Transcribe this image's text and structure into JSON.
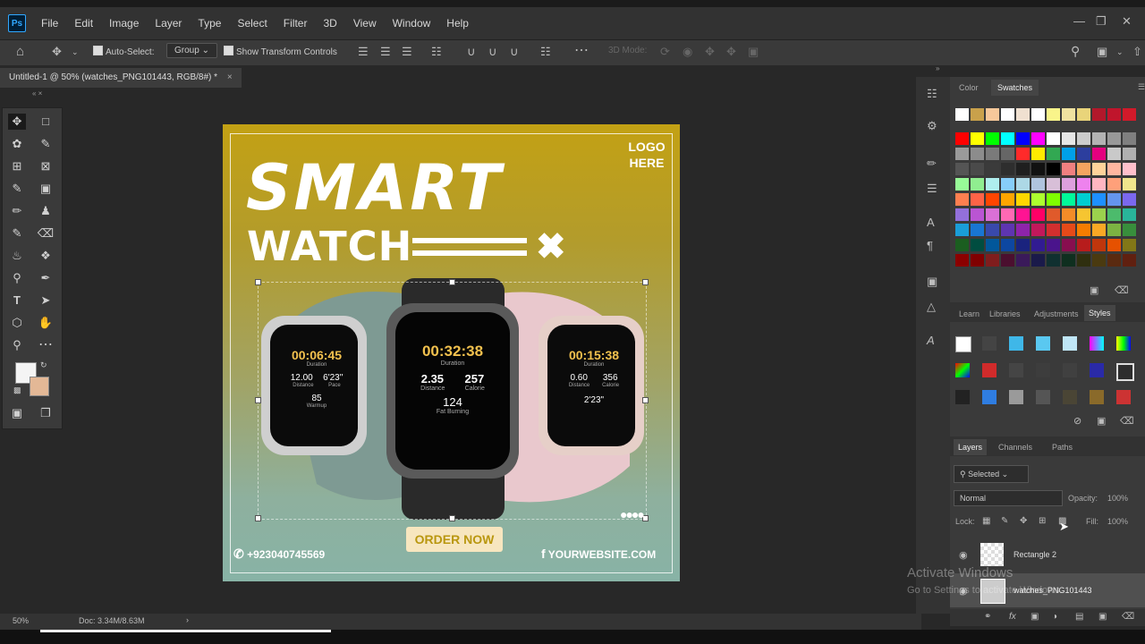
{
  "app": {
    "icon_label": "Ps"
  },
  "menu": [
    "File",
    "Edit",
    "Image",
    "Layer",
    "Type",
    "Select",
    "Filter",
    "3D",
    "View",
    "Window",
    "Help"
  ],
  "options": {
    "auto_select_label": "Auto-Select:",
    "auto_select_value": "Group",
    "show_transform_label": "Show Transform Controls",
    "mode_3d_label": "3D Mode:"
  },
  "document": {
    "tab_title": "Untitled-1 @ 50% (watches_PNG101443, RGB/8#) *"
  },
  "artwork": {
    "headline": "SMART",
    "subheadline": "WATCH",
    "logo_text": "LOGO HERE",
    "cta": "ORDER NOW",
    "phone": "+923040745569",
    "website": "YOURWEBSITE.COM",
    "watches": [
      {
        "time": "00:06:45",
        "label": "Duration",
        "stat1": "12.00",
        "stat1_label": "Distance",
        "stat2": "6'23\"",
        "stat2_label": "Pace",
        "hr": "85",
        "hr_label": "Warmup"
      },
      {
        "time": "00:32:38",
        "label": "Duration",
        "stat1": "2.35",
        "stat1_label": "Distance",
        "stat2": "257",
        "stat2_label": "Calorie",
        "hr": "124",
        "hr_label": "Fat Burning"
      },
      {
        "time": "00:15:38",
        "label": "Duration",
        "stat1": "0.60",
        "stat1_label": "Distance",
        "stat2": "356",
        "stat2_label": "Calorie",
        "hr": "2'23\"",
        "hr_label": ""
      }
    ]
  },
  "panels": {
    "color_tab": "Color",
    "swatches_tab": "Swatches",
    "lower_tabs": [
      "Learn",
      "Libraries",
      "Adjustments",
      "Styles"
    ],
    "layers_tabs": [
      "Layers",
      "Channels",
      "Paths"
    ],
    "filter_value": "Selected",
    "blend_mode": "Normal",
    "opacity_label": "Opacity:",
    "opacity_value": "100%",
    "lock_label": "Lock:",
    "fill_label": "Fill:",
    "fill_value": "100%",
    "layers": [
      {
        "name": "Rectangle 2"
      },
      {
        "name": "watches_PNG101443"
      }
    ]
  },
  "status": {
    "zoom": "50%",
    "doc_size": "Doc: 3.34M/8.63M"
  },
  "watermark": {
    "line1": "Activate Windows",
    "line2": "Go to Settings to activate Windows."
  },
  "swatch_colors": {
    "row1": [
      "#ffffff",
      "#c9a14b",
      "#f6c89a",
      "#ffffff",
      "#f0e0d0",
      "#ffffff",
      "#f9f48a",
      "#f0e2a0",
      "#e9d47a",
      "#b2182b",
      "#c0152c",
      "#d11a2a"
    ],
    "grid": [
      [
        "#ff0000",
        "#ffff00",
        "#00ff00",
        "#00ffff",
        "#0000ff",
        "#ff00ff",
        "#ffffff",
        "#e6e6e6",
        "#cccccc",
        "#b3b3b3",
        "#999999",
        "#808080"
      ],
      [
        "#9a9a9a",
        "#8c8c8c",
        "#7a7a7a",
        "#666666",
        "#ff2a2a",
        "#ffeb00",
        "#32a852",
        "#00a0e9",
        "#2c3e9e",
        "#e4007f",
        "#c9c9c9",
        "#b0b0b0"
      ],
      [
        "#555555",
        "#4a4a4a",
        "#3b3b3b",
        "#2e2e2e",
        "#1f1f1f",
        "#111111",
        "#000000",
        "#f08080",
        "#f4a460",
        "#ffd39b",
        "#ffb6a0",
        "#ffc0cb"
      ],
      [
        "#98fb98",
        "#90ee90",
        "#afeeee",
        "#87cefa",
        "#add8e6",
        "#b0c4de",
        "#d8bfd8",
        "#dda0dd",
        "#ee82ee",
        "#ffb6c1",
        "#ffa07a",
        "#f0e68c"
      ],
      [
        "#ff7f50",
        "#ff6347",
        "#ff4500",
        "#ffa500",
        "#ffd700",
        "#adff2f",
        "#7fff00",
        "#00fa9a",
        "#00ced1",
        "#1e90ff",
        "#6495ed",
        "#7b68ee"
      ],
      [
        "#9370db",
        "#ba55d3",
        "#da70d6",
        "#ff69b4",
        "#ff1493",
        "#ff0066",
        "#e05a2b",
        "#f28c28",
        "#f6c531",
        "#9bd14d",
        "#4cbb6c",
        "#29b59a"
      ],
      [
        "#1a9ed8",
        "#1976d2",
        "#3949ab",
        "#5e35b1",
        "#8e24aa",
        "#c2185b",
        "#d32f2f",
        "#e64a19",
        "#f57c00",
        "#f9a825",
        "#7cb342",
        "#388e3c"
      ],
      [
        "#1b5e20",
        "#004d40",
        "#01579b",
        "#0d47a1",
        "#1a237e",
        "#311b92",
        "#4a148c",
        "#880e4f",
        "#b71c1c",
        "#bf360c",
        "#e65100",
        "#827717"
      ],
      [
        "#8b0000",
        "#800000",
        "#7f1d1d",
        "#4b0f2f",
        "#3a1a5a",
        "#1a1a4a",
        "#103030",
        "#0f2f1f",
        "#2f2f0f",
        "#4a3a10",
        "#5a2a10",
        "#602010"
      ]
    ]
  }
}
